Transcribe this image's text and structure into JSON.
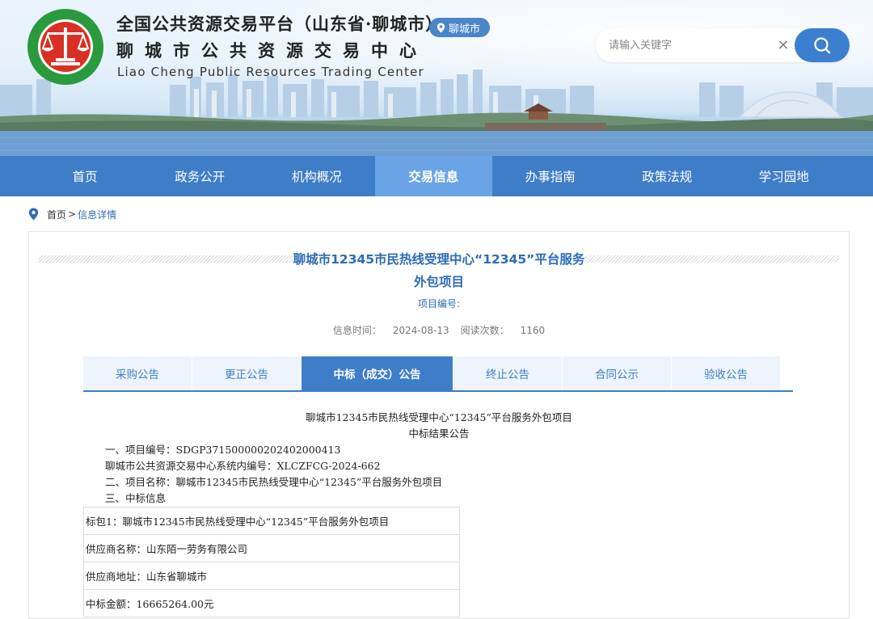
{
  "header": {
    "title_cn": "全国公共资源交易平台（山东省·聊城市）",
    "center_name": "聊城市公共资源交易中心",
    "center_name_en": "Liao Cheng Public Resources Trading Center",
    "city_badge": "聊城市",
    "search": {
      "placeholder": "请输入关键字",
      "value": ""
    },
    "colors": {
      "nav": "#3e7ec9",
      "nav_active": "#6aa4e6",
      "link": "#2e6bb7",
      "logo_green": "#2a9a3e",
      "logo_red": "#d93025"
    }
  },
  "nav": {
    "items": [
      {
        "label": "首页",
        "active": false
      },
      {
        "label": "政务公开",
        "active": false
      },
      {
        "label": "机构概况",
        "active": false
      },
      {
        "label": "交易信息",
        "active": true
      },
      {
        "label": "办事指南",
        "active": false
      },
      {
        "label": "政策法规",
        "active": false
      },
      {
        "label": "学习园地",
        "active": false
      }
    ]
  },
  "breadcrumb": {
    "home": "首页",
    "separator": ">",
    "current": "信息详情"
  },
  "article": {
    "title_line1": "聊城市12345市民热线受理中心“12345”平台服务",
    "title_line2": "外包项目",
    "project_no_label": "项目编号:",
    "info_time_label": "信息时间：",
    "info_time": "2024-08-13",
    "views_label": "阅读次数：",
    "views": "1160",
    "tabs": [
      {
        "label": "采购公告",
        "active": false
      },
      {
        "label": "更正公告",
        "active": false
      },
      {
        "label": "中标（成交）公告",
        "active": true
      },
      {
        "label": "终止公告",
        "active": false
      },
      {
        "label": "合同公示",
        "active": false
      },
      {
        "label": "验收公告",
        "active": false
      }
    ],
    "doc_heading1": "聊城市12345市民热线受理中心“12345”平台服务外包项目",
    "doc_heading2": "中标结果公告",
    "line1": "一、项目编号：SDGP371500000202402000413",
    "line2": "聊城市公共资源交易中心系统内编号：XLCZFCG-2024-662",
    "line3": "二、项目名称：聊城市12345市民热线受理中心“12345”平台服务外包项目",
    "line4": "三、中标信息",
    "table": {
      "row1": "标包1：聊城市12345市民热线受理中心“12345”平台服务外包项目",
      "row2": "供应商名称：山东陌一劳务有限公司",
      "row3": "供应商地址：山东省聊城市",
      "row4": "中标金额：16665264.00元"
    }
  }
}
